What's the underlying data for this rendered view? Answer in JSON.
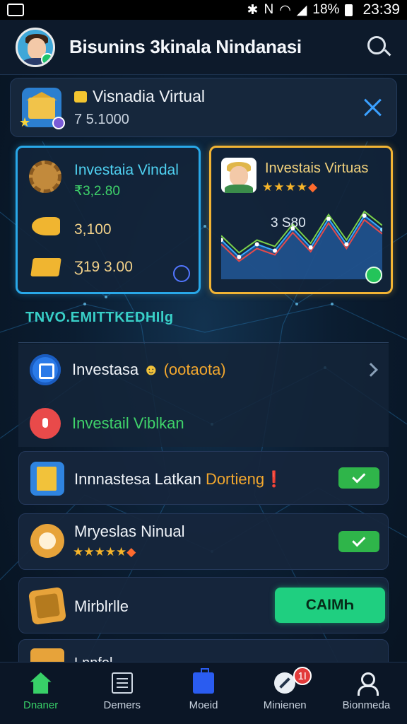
{
  "status_bar": {
    "battery_text": "18%",
    "time": "23:39"
  },
  "header": {
    "title": "Bisunins 3kinala Nindanasi"
  },
  "top_card": {
    "name": "Visnadia Virtual",
    "amount": "7 5.1000"
  },
  "card_left": {
    "title": "Investaia Vindal",
    "value": "₹3,2.80",
    "row1": "3,100",
    "row2": "Ʒ19 3.00"
  },
  "card_right": {
    "title": "Investais Virtuas",
    "stars": "★★★★",
    "chart_label": "3 S80",
    "chart_values": [
      0.62,
      0.35,
      0.55,
      0.45,
      0.8,
      0.5,
      0.95,
      0.55,
      1.0,
      0.78
    ],
    "chart_colors": {
      "fill": "#2a72c8",
      "line1": "#38a8ff",
      "line2": "#e64a4a",
      "line3": "#7ad14a"
    }
  },
  "section_label": "TNVO.EMITTKEDHIlg",
  "list": [
    {
      "label_main": "Investasa",
      "label_extra": "(ootaota)",
      "color": "#f0f4f9"
    },
    {
      "label_main": "Investail Viblkan",
      "label_extra": "",
      "color": "#3fd36a"
    }
  ],
  "rows": [
    {
      "label": "Innnastesa Latkan",
      "accent": "Dortieng❗",
      "toggle_on": true
    },
    {
      "label": "Mryeslas Ninual",
      "stars": "★★★★★",
      "toggle_on": true
    },
    {
      "label": "Mirblrlle",
      "button": "CAIMҺ"
    }
  ],
  "partial_row": {
    "label": "Lnnfol"
  },
  "bottom_nav": [
    {
      "label": "Dnaner",
      "active": true
    },
    {
      "label": "Demers",
      "active": false
    },
    {
      "label": "Moeid",
      "active": false
    },
    {
      "label": "Minienen",
      "active": false,
      "badge": "1I"
    },
    {
      "label": "Bionmeda",
      "active": false
    }
  ]
}
